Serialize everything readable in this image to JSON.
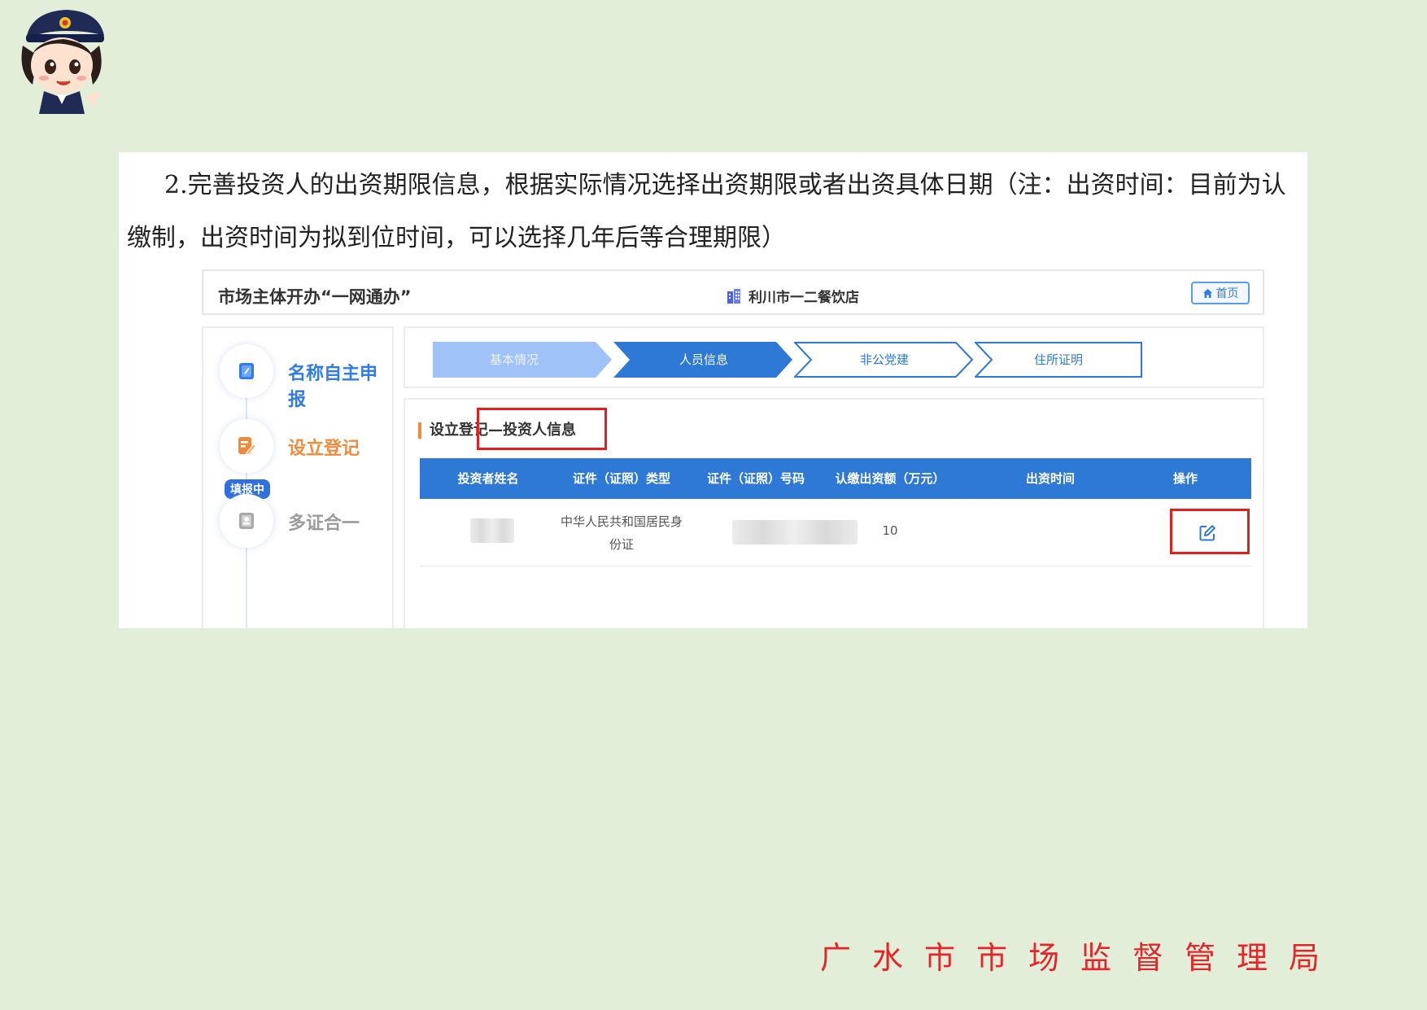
{
  "instruction": "2.完善投资人的出资期限信息，根据实际情况选择出资期限或者出资具体日期（注：出资时间：目前为认缴制，出资时间为拟到位时间，可以选择几年后等合理期限）",
  "app": {
    "title": "市场主体开办“一网通办”",
    "shop_name": "利川市一二餐饮店",
    "home_label": "首页"
  },
  "sidebar": {
    "items": [
      {
        "label": "名称自主申报",
        "icon": "notebook-icon",
        "color": "#2f7be7"
      },
      {
        "label": "设立登记",
        "icon": "edit-form-icon",
        "color": "#f08a3c",
        "badge": "填报中"
      },
      {
        "label": "多证合一",
        "icon": "certificate-icon",
        "color": "#9b9b9b"
      }
    ]
  },
  "steps": [
    {
      "label": "基本情况",
      "state": "done"
    },
    {
      "label": "人员信息",
      "state": "active"
    },
    {
      "label": "非公党建",
      "state": "pending"
    },
    {
      "label": "住所证明",
      "state": "pending"
    }
  ],
  "section_title": "设立登记—投资人信息",
  "table": {
    "headers": [
      "投资者姓名",
      "证件（证照）类型",
      "证件（证照）号码",
      "认缴出资额（万元）",
      "出资时间",
      "操作"
    ],
    "rows": [
      {
        "id_type_line1": "中华人民共和国居民身",
        "id_type_line2": "份证",
        "amount": "10",
        "contribution_time": ""
      }
    ]
  },
  "colors": {
    "accent": "#2e78d6",
    "highlight": "#e02020",
    "background": "#e3eed9"
  },
  "footer": "广水市市场监督管理局"
}
